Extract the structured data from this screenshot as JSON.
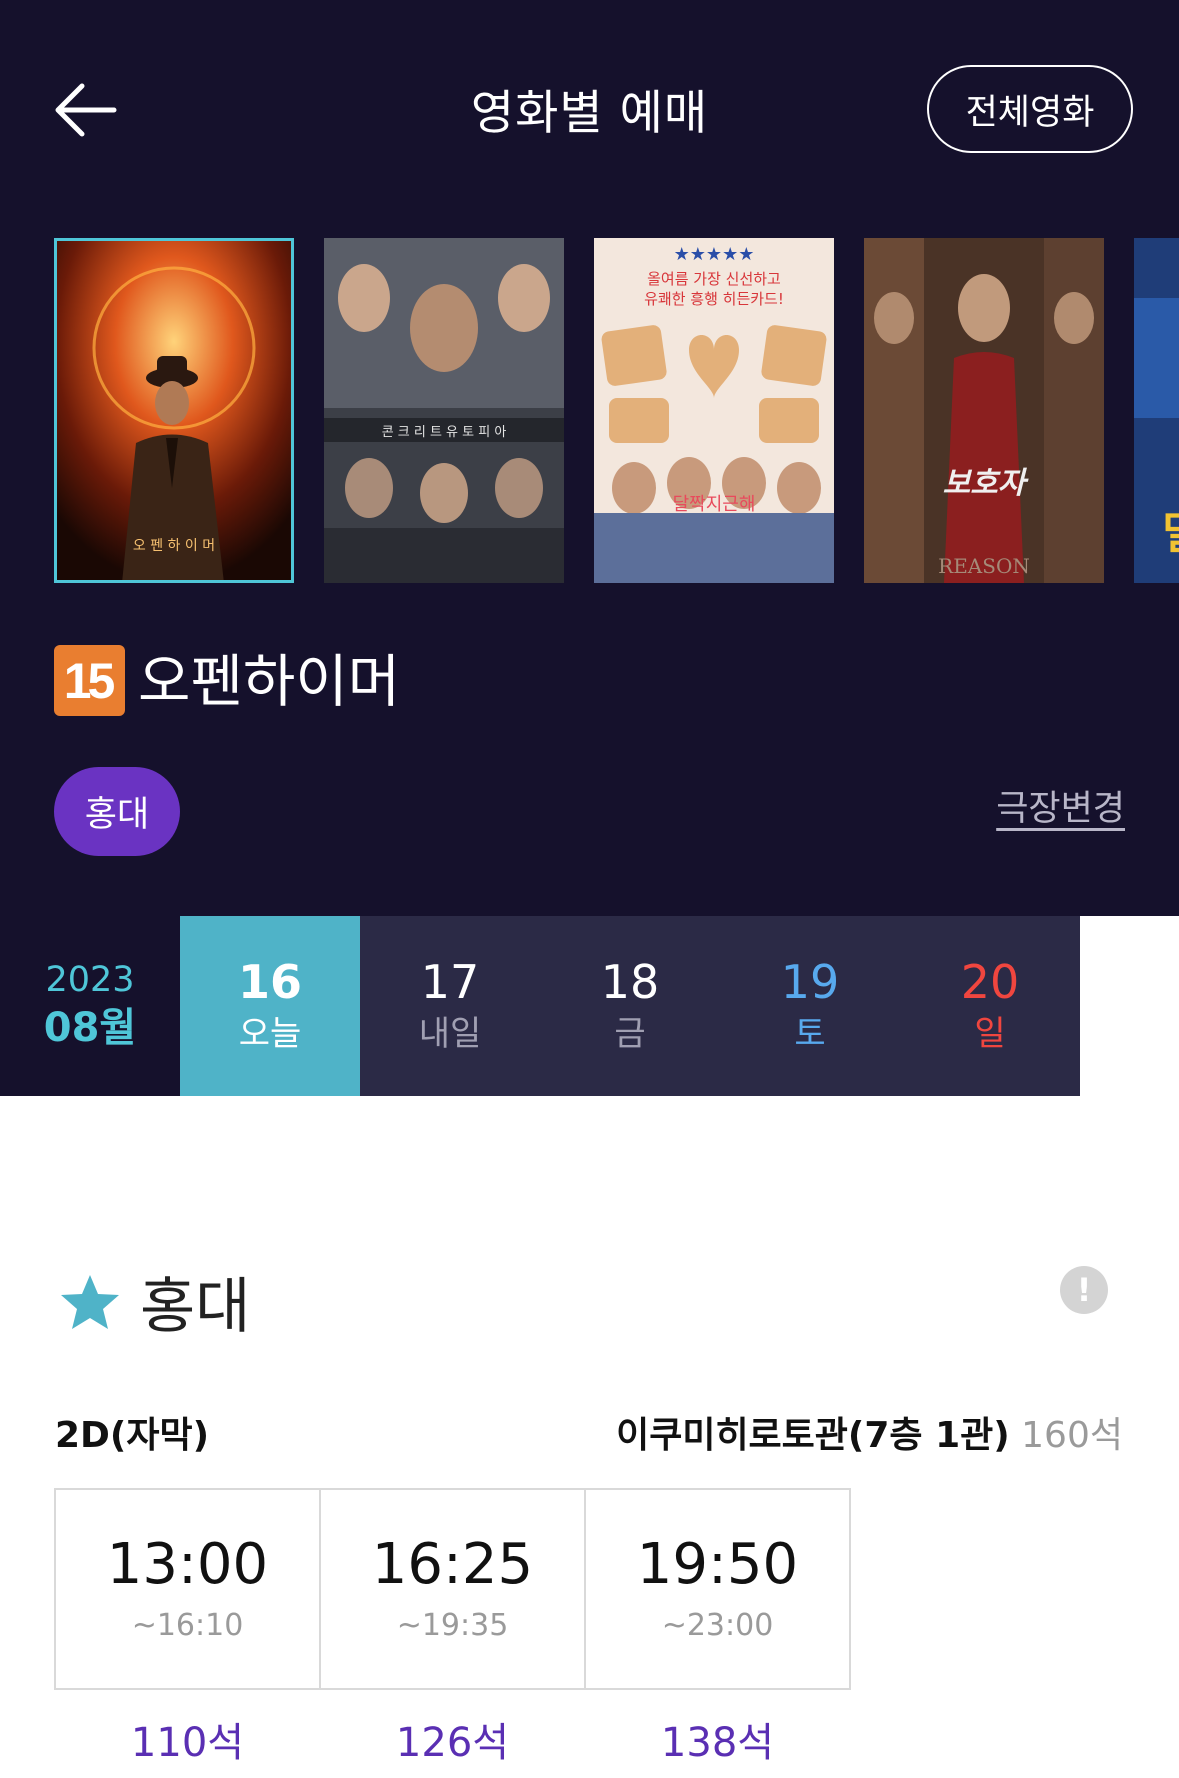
{
  "header": {
    "title": "영화별 예매",
    "all_movies_label": "전체영화"
  },
  "posters": [
    {
      "title_text": "오펜하이머",
      "selected": true
    },
    {
      "title_text": "콘크리트 유토피아",
      "selected": false
    },
    {
      "title_text": "올여름 가장 신선하고 유쾌한 흥행 히든카드!",
      "selected": false
    },
    {
      "title_text": "보호자",
      "selected": false
    },
    {
      "title_text": "밀",
      "selected": false
    }
  ],
  "movie": {
    "rating": "15",
    "title": "오펜하이머"
  },
  "theater_filter": {
    "selected": "홍대",
    "change_label": "극장변경"
  },
  "dates": {
    "year": "2023",
    "month": "08월",
    "days": [
      {
        "num": "16",
        "label": "오늘",
        "active": true
      },
      {
        "num": "17",
        "label": "내일"
      },
      {
        "num": "18",
        "label": "금"
      },
      {
        "num": "19",
        "label": "토"
      },
      {
        "num": "20",
        "label": "일"
      }
    ]
  },
  "theater": {
    "name": "홍대",
    "format": "2D(자막)",
    "hall_name": "이쿠미히로토관(7층 1관)",
    "hall_seats": "160석",
    "showtimes": [
      {
        "start": "13:00",
        "end": "~16:10",
        "seats": "110석"
      },
      {
        "start": "16:25",
        "end": "~19:35",
        "seats": "126석"
      },
      {
        "start": "19:50",
        "end": "~23:00",
        "seats": "138석"
      }
    ]
  },
  "colors": {
    "header_bg": "#15112c",
    "accent_cyan": "#4fb3c8",
    "accent_purple": "#6a33c2",
    "saturday": "#58a9ee",
    "sunday": "#f0463f",
    "rating_15": "#e97e30"
  }
}
